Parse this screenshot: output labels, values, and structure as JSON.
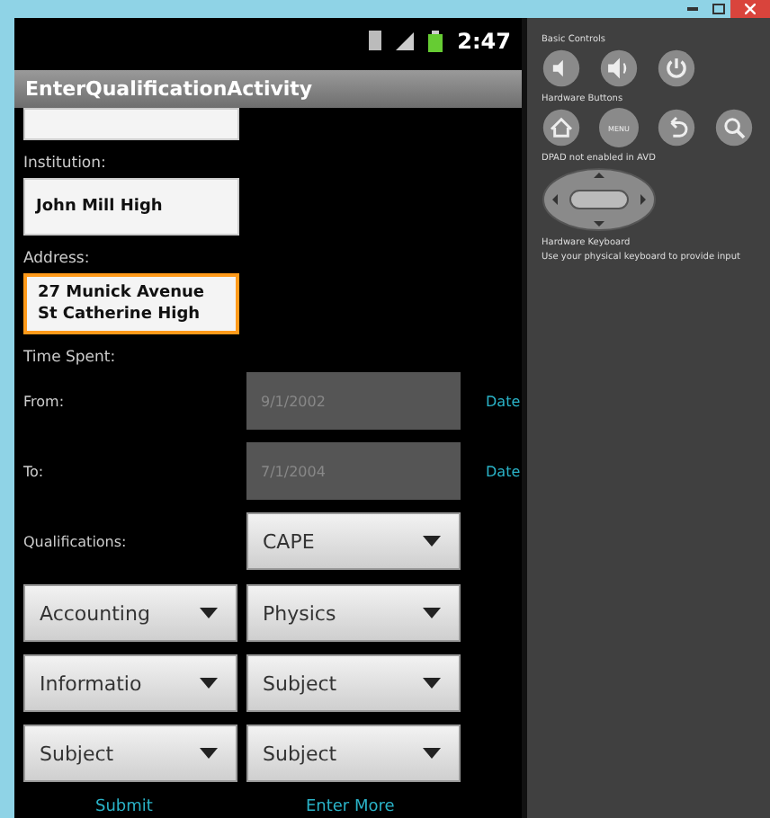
{
  "status_bar": {
    "time": "2:47"
  },
  "app_bar": {
    "title": "EnterQualificationActivity"
  },
  "form": {
    "institution": {
      "label": "Institution:",
      "value": "John Mill High"
    },
    "address": {
      "label": "Address:",
      "lines": [
        "27 Munick Avenue",
        "St Catherine High"
      ],
      "focused": true
    },
    "time_spent": {
      "label": "Time Spent:"
    },
    "dates": [
      {
        "label": "From:",
        "value": "9/1/2002",
        "link": "Date",
        "disabled": true
      },
      {
        "label": "To:",
        "value": "7/1/2004",
        "link": "Date",
        "disabled": true
      }
    ],
    "qualifications": {
      "label": "Qualifications:",
      "value": "CAPE"
    },
    "subject_spinners": [
      [
        "Accounting",
        "Physics"
      ],
      [
        "Informatio",
        "Subject"
      ],
      [
        "Subject",
        "Subject"
      ]
    ],
    "buttons": [
      "Submit",
      "Enter More"
    ]
  },
  "controls_panel": {
    "basic_controls": {
      "label": "Basic Controls"
    },
    "hardware_buttons": {
      "label": "Hardware Buttons",
      "menu_label": "MENU"
    },
    "dpad": {
      "label": "DPAD not enabled in AVD"
    },
    "keyboard": {
      "label": "Hardware Keyboard",
      "hint": "Use your physical keyboard to provide input"
    }
  }
}
